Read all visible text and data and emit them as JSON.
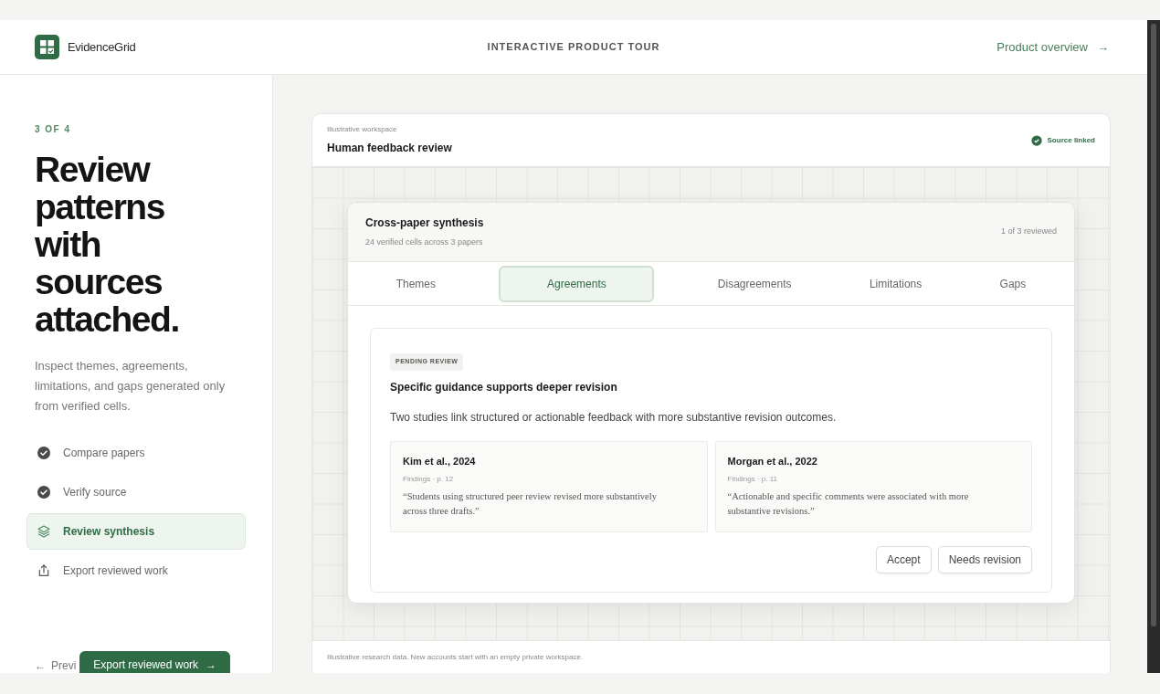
{
  "brand": {
    "name": "EvidenceGrid"
  },
  "header": {
    "title": "INTERACTIVE PRODUCT TOUR",
    "link": "Product overview",
    "link_arrow": "→"
  },
  "tour": {
    "step_label": "3 OF 4",
    "heading": "Review patterns with sources attached.",
    "description": "Inspect themes, agreements, limitations, and gaps generated only from verified cells.",
    "steps": [
      {
        "label": "Compare papers",
        "kind": "done",
        "selected": false
      },
      {
        "label": "Verify source",
        "kind": "done",
        "selected": false
      },
      {
        "label": "Review synthesis",
        "kind": "current",
        "selected": true
      },
      {
        "label": "Export reviewed work",
        "kind": "pending",
        "selected": false
      }
    ],
    "previous": {
      "arrow": "←",
      "label": "Previ"
    },
    "next": {
      "label": "Export reviewed work",
      "arrow": "→"
    }
  },
  "workspace": {
    "caption": "Illustrative workspace",
    "title": "Human feedback review",
    "status": "Source linked",
    "footer": "Illustrative research data. New accounts start with an empty private workspace.",
    "synthesis": {
      "title": "Cross-paper synthesis",
      "subtitle": "24 verified cells across 3 papers",
      "progress": "1 of 3 reviewed",
      "tabs": [
        {
          "label": "Themes",
          "selected": false
        },
        {
          "label": "Agreements",
          "selected": true
        },
        {
          "label": "Disagreements",
          "selected": false
        },
        {
          "label": "Limitations",
          "selected": false
        },
        {
          "label": "Gaps",
          "selected": false
        }
      ],
      "finding": {
        "badge": "PENDING REVIEW",
        "title": "Specific guidance supports deeper revision",
        "summary": "Two studies link structured or actionable feedback with more substantive revision outcomes.",
        "sources": [
          {
            "citation": "Kim et al., 2024",
            "location": "Findings · p. 12",
            "quote": "“Students using structured peer review revised more substantively across three drafts.”"
          },
          {
            "citation": "Morgan et al., 2022",
            "location": "Findings · p. 11",
            "quote": "“Actionable and specific comments were associated with more substantive revisions.”"
          }
        ],
        "actions": [
          "Accept",
          "Needs revision"
        ]
      }
    }
  }
}
